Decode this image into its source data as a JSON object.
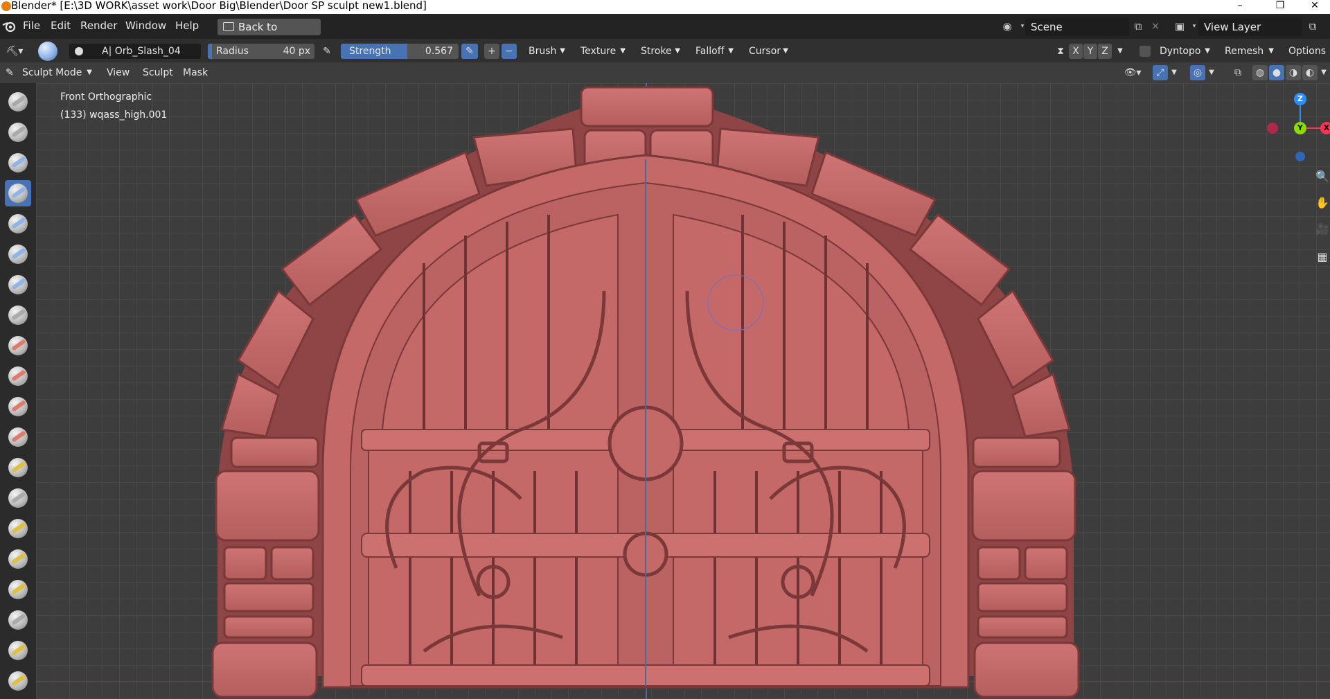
{
  "titlebar": {
    "title": "Blender* [E:\\3D WORK\\asset work\\Door Big\\Blender\\Door SP sculpt new1.blend]",
    "minimize": "–",
    "restore": "❐",
    "close": "✕"
  },
  "menubar": {
    "items": [
      "File",
      "Edit",
      "Render",
      "Window",
      "Help"
    ],
    "back_button": "Back to Previous",
    "scene": "Scene",
    "view_layer": "View Layer"
  },
  "toolheader": {
    "brush_name": "A| Orb_Slash_04",
    "radius_label": "Radius",
    "radius_value": "40 px",
    "strength_label": "Strength",
    "strength_value": "0.567",
    "strength_fraction": 0.567,
    "plus": "+",
    "minus": "−",
    "menus": [
      "Brush",
      "Texture",
      "Stroke",
      "Falloff",
      "Cursor"
    ],
    "axes": [
      "X",
      "Y",
      "Z"
    ],
    "dyntopo": "Dyntopo",
    "remesh": "Remesh",
    "options": "Options"
  },
  "modeheader": {
    "mode": "Sculpt Mode",
    "menus": [
      "View",
      "Sculpt",
      "Mask"
    ]
  },
  "viewport": {
    "view_name": "Front Orthographic",
    "object_info": "(133) wqass_high.001",
    "gizmo": {
      "z": "Z",
      "y": "Y",
      "x": "X"
    }
  },
  "colors": {
    "accent": "#4772b3",
    "model": "#c46868",
    "model_shadow": "#8a4040",
    "axis_red": "#ff3352",
    "axis_green": "#8bdc00",
    "axis_blue": "#2c8fff"
  },
  "tools": [
    {
      "icon": "draw-brush-icon",
      "color": "#aaaaaa"
    },
    {
      "icon": "draw-sharp-brush-icon",
      "color": "#aaaaaa"
    },
    {
      "icon": "clay-brush-icon",
      "color": "#8fb4e8"
    },
    {
      "icon": "clay-strips-brush-icon",
      "color": "#8fb4e8"
    },
    {
      "icon": "layer-brush-icon",
      "color": "#8fb4e8"
    },
    {
      "icon": "inflate-brush-icon",
      "color": "#8fb4e8"
    },
    {
      "icon": "blob-brush-icon",
      "color": "#8fb4e8"
    },
    {
      "icon": "crease-brush-icon",
      "color": "#aaaaaa"
    },
    {
      "icon": "smooth-brush-icon",
      "color": "#e07a6a"
    },
    {
      "icon": "flatten-brush-icon",
      "color": "#e07a6a"
    },
    {
      "icon": "fill-brush-icon",
      "color": "#e07a6a"
    },
    {
      "icon": "scrape-brush-icon",
      "color": "#e07a6a"
    },
    {
      "icon": "multiplane-scrape-brush-icon",
      "color": "#e0c040"
    },
    {
      "icon": "pinch-brush-icon",
      "color": "#aaaaaa"
    },
    {
      "icon": "grab-brush-icon",
      "color": "#e0c040"
    },
    {
      "icon": "elastic-deform-brush-icon",
      "color": "#e0c040"
    },
    {
      "icon": "snake-hook-brush-icon",
      "color": "#e0c040"
    },
    {
      "icon": "thumb-brush-icon",
      "color": "#aaaaaa"
    },
    {
      "icon": "pose-brush-icon",
      "color": "#e0c040"
    },
    {
      "icon": "rotate-brush-icon",
      "color": "#e0c040"
    }
  ]
}
